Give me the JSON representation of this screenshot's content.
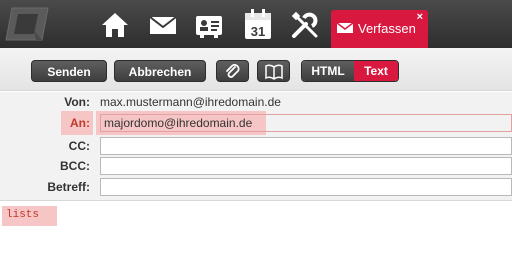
{
  "nav": {
    "icons": [
      "logo-icon",
      "home-icon",
      "mail-icon",
      "contacts-icon",
      "calendar-icon",
      "settings-icon"
    ],
    "calendar_day": "31",
    "compose_tab": {
      "label": "Verfassen",
      "close": "×",
      "icon": "mail-icon"
    }
  },
  "toolbar": {
    "send_label": "Senden",
    "cancel_label": "Abbrechen",
    "attach_icon": "paperclip-icon",
    "addressbook_icon": "book-icon",
    "format_html": "HTML",
    "format_text": "Text",
    "active_format": "Text"
  },
  "fields": {
    "from_label": "Von:",
    "from_value": "max.mustermann@ihredomain.de",
    "to_label": "An:",
    "to_value": "majordomo@ihredomain.de",
    "cc_label": "CC:",
    "cc_value": "",
    "bcc_label": "BCC:",
    "bcc_value": "",
    "subject_label": "Betreff:",
    "subject_value": ""
  },
  "body": {
    "text": "lists"
  },
  "colors": {
    "accent": "#d9183f",
    "highlight": "#f6c6c6",
    "topbar": "#3a3a3a"
  }
}
